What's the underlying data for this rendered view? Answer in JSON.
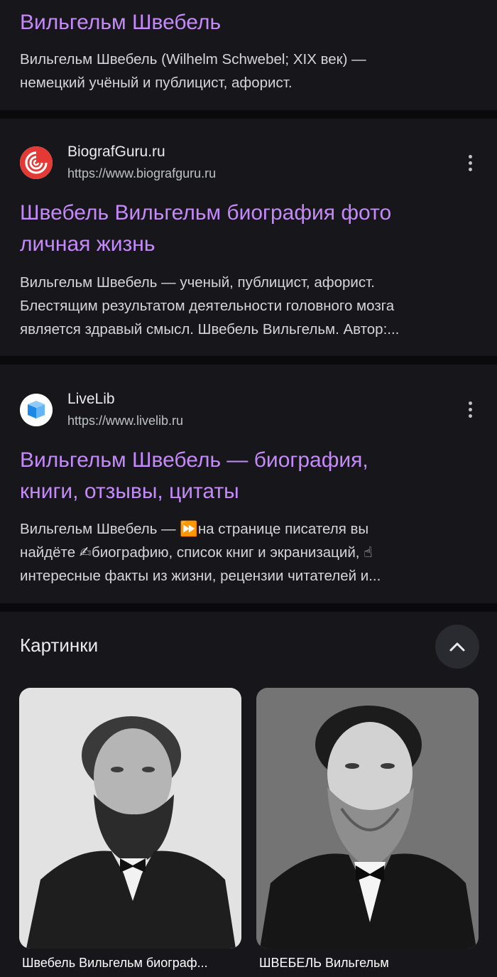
{
  "result0": {
    "title": "Вильгельм Швебель",
    "snippet_line1": "Вильгельм Швебель (Wilhelm Schwebel; XIX век) —",
    "snippet_line2": "немецкий учёный и публицист, афорист."
  },
  "result1": {
    "site_name": "BiografGuru.ru",
    "site_url": "https://www.biografguru.ru",
    "favicon": "biografguru-logo-icon",
    "title_line1": "Швебель Вильгельм биография фото",
    "title_line2": "личная жизнь",
    "snippet_line1": "Вильгельм Швебель — ученый, публицист, афорист.",
    "snippet_line2": "Блестящим результатом деятельности головного мозга",
    "snippet_line3": "является здравый смысл. Швебель Вильгельм. Автор:..."
  },
  "result2": {
    "site_name": "LiveLib",
    "site_url": "https://www.livelib.ru",
    "favicon": "livelib-book-icon",
    "title_line1": "Вильгельм Швебель — биография,",
    "title_line2": "книги, отзывы, цитаты",
    "snippet_line1": "Вильгельм Швебель — ⏩на странице писателя вы",
    "snippet_line2": "найдёте ✍биографию, список книг и экранизаций, ☝",
    "snippet_line3": "интересные факты из жизни, рецензии читателей и..."
  },
  "images": {
    "section_title": "Картинки",
    "collapse_icon": "chevron-up-icon",
    "items": [
      {
        "caption": "Швебель Вильгельм биограф...",
        "image": "portrait-photo"
      },
      {
        "caption": "ШВЕБЕЛЬ Вильгельм",
        "image": "portrait-photo"
      }
    ]
  },
  "colors": {
    "link": "#c58af9",
    "card": "#17171b",
    "background": "#0f0f12"
  }
}
